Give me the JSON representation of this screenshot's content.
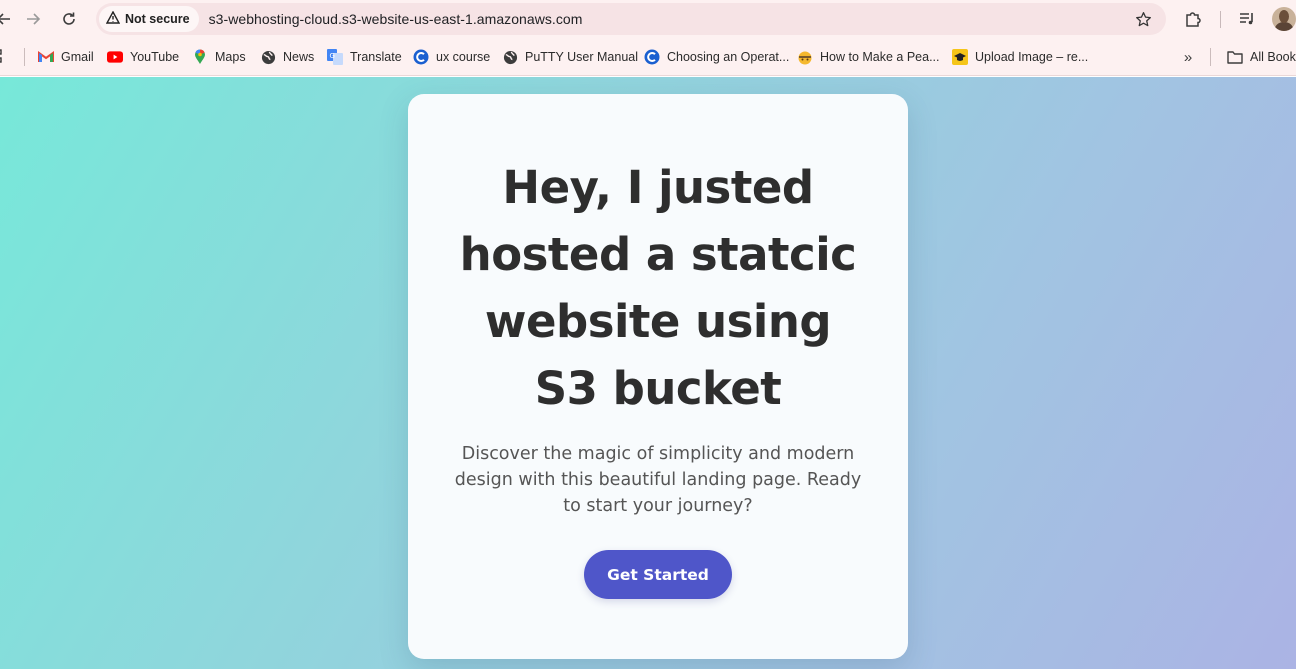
{
  "browser": {
    "security_chip": "Not secure",
    "url": "s3-webhosting-cloud.s3-website-us-east-1.amazonaws.com"
  },
  "bookmarks": [
    {
      "label": "Gmail",
      "icon": "gmail-icon"
    },
    {
      "label": "YouTube",
      "icon": "youtube-icon"
    },
    {
      "label": "Maps",
      "icon": "maps-icon"
    },
    {
      "label": "News",
      "icon": "globe-icon"
    },
    {
      "label": "Translate",
      "icon": "translate-icon"
    },
    {
      "label": "ux course",
      "icon": "c-logo-icon"
    },
    {
      "label": "PuTTY User Manual",
      "icon": "globe-icon"
    },
    {
      "label": "Choosing an Operat...",
      "icon": "c-logo-icon"
    },
    {
      "label": "How to Make a Pea...",
      "icon": "emoji-icon"
    },
    {
      "label": "Upload Image – re...",
      "icon": "graduation-cap-icon"
    }
  ],
  "all_bookmarks_label": "All Book",
  "hero": {
    "headline": "Hey, I justed hosted a statcic website using S3 bucket",
    "subtext": "Discover the magic of simplicity and modern design with this beautiful landing page. Ready to start your journey?",
    "cta_label": "Get Started"
  },
  "colors": {
    "cta": "#4f56c9",
    "gradient_start": "#77e8d9",
    "gradient_end": "#abb3e4"
  }
}
